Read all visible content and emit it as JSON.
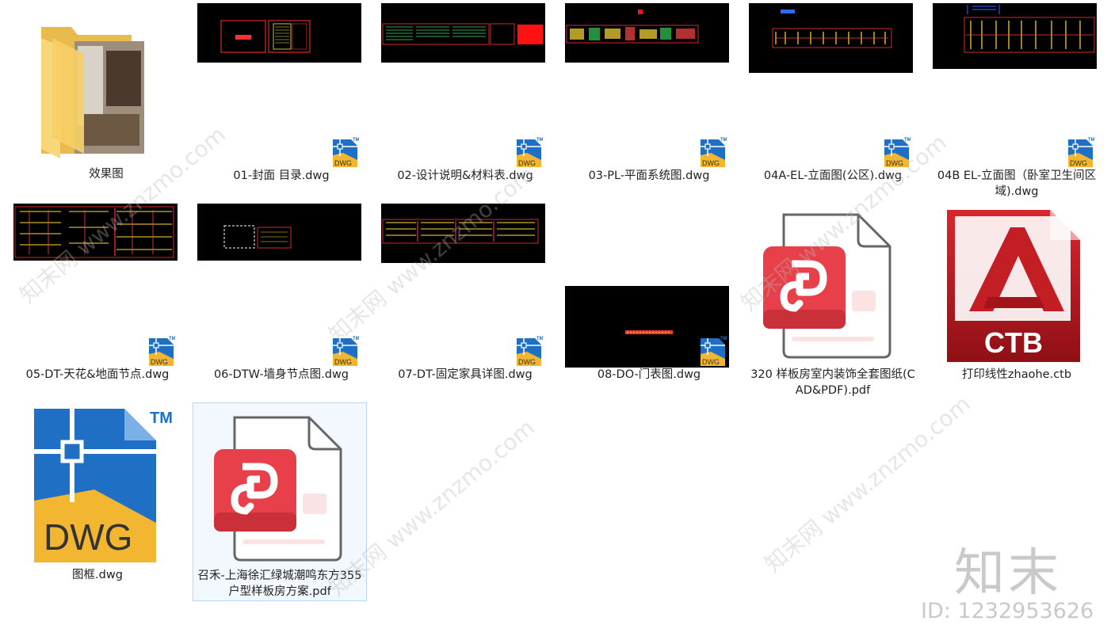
{
  "files": [
    {
      "name": "效果图",
      "type": "folder"
    },
    {
      "name": "01-封面 目录.dwg",
      "type": "dwg"
    },
    {
      "name": "02-设计说明&材料表.dwg",
      "type": "dwg"
    },
    {
      "name": "03-PL-平面系统图.dwg",
      "type": "dwg"
    },
    {
      "name": "04A-EL-立面图(公区).dwg",
      "type": "dwg"
    },
    {
      "name": "04B EL-立面图（卧室卫生间区域).dwg",
      "type": "dwg"
    },
    {
      "name": "05-DT-天花&地面节点.dwg",
      "type": "dwg"
    },
    {
      "name": "06-DTW-墙身节点图.dwg",
      "type": "dwg"
    },
    {
      "name": "07-DT-固定家具详图.dwg",
      "type": "dwg"
    },
    {
      "name": "08-DO-门表图.dwg",
      "type": "dwg"
    },
    {
      "name": "320 样板房室内装饰全套图纸(CAD&PDF).pdf",
      "type": "pdf"
    },
    {
      "name": "打印线性zhaohe.ctb",
      "type": "ctb"
    },
    {
      "name": "图框.dwg",
      "type": "dwg"
    },
    {
      "name": "召禾-上海徐汇绿城潮鸣东方355户型样板房方案.pdf",
      "type": "pdf",
      "selected": true
    }
  ],
  "icons": {
    "dwg_badge": "DWG",
    "trademark": "TM",
    "ctb_label": "CTB"
  },
  "watermark": {
    "logo": "知末",
    "id_text": "ID: 1232953626",
    "diagonal": "知末网 www.znzmo.com"
  },
  "colors": {
    "dwg_blue": "#1f6fc4",
    "dwg_yellow": "#f2b630",
    "pdf_red": "#e8404a",
    "autocad_red": "#c41e25",
    "folder_yellow": "#f8d77b",
    "selection_bg": "#f2f8fe"
  }
}
